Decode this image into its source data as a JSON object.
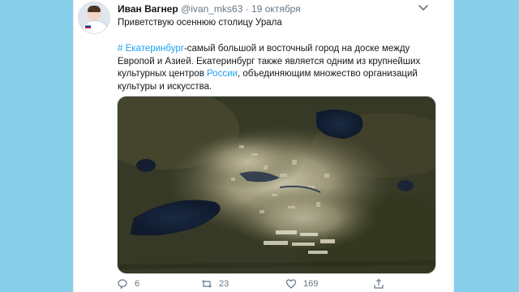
{
  "tweet": {
    "author_name": "Иван Вагнер",
    "author_handle": "@ivan_mks63",
    "separator": "·",
    "date": "19 октября",
    "line1": "Приветствую осеннюю столицу Урала",
    "hashtag": "# Екатеринбург",
    "text_a": "-самый большой и восточный город на доске между Европой и Азией. Екатеринбург также является одним из крупнейших культурных центров ",
    "link_russia": "России",
    "text_b": ", объединяющим множество организаций культуры и искусства."
  },
  "actions": {
    "reply_count": "6",
    "retweet_count": "23",
    "like_count": "169"
  },
  "icons": [
    "chevron-down-icon",
    "reply-icon",
    "retweet-icon",
    "like-icon",
    "share-icon"
  ],
  "colors": {
    "background": "#87ceeb",
    "link": "#1da1f2",
    "secondary_text": "#657786",
    "primary_text": "#14171a"
  }
}
